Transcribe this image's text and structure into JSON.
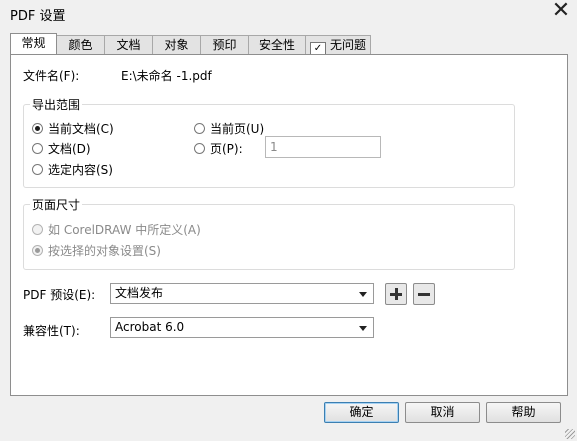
{
  "window": {
    "title": "PDF 设置",
    "close_glyph": "✕"
  },
  "tabs": [
    {
      "label": "常规",
      "active": true
    },
    {
      "label": "颜色"
    },
    {
      "label": "文档"
    },
    {
      "label": "对象"
    },
    {
      "label": "预印"
    },
    {
      "label": "安全性"
    },
    {
      "label": "无问题",
      "icon": "checklist-icon"
    }
  ],
  "general": {
    "filename_label": "文件名(F):",
    "filename_value": "E:\\未命名 -1.pdf",
    "export_range": {
      "title": "导出范围",
      "opt_current_doc": "当前文档(C)",
      "opt_doc": "文档(D)",
      "opt_selection": "选定内容(S)",
      "opt_current_page": "当前页(U)",
      "opt_pages": "页(P):",
      "pages_value": "1"
    },
    "page_size": {
      "title": "页面尺寸",
      "opt_as_defined": "如 CorelDRAW 中所定义(A)",
      "opt_by_object": "按选择的对象设置(S)"
    },
    "preset_label": "PDF 预设(E):",
    "preset_value": "文档发布",
    "compat_label": "兼容性(T):",
    "compat_value": "Acrobat 6.0"
  },
  "buttons": {
    "ok": "确定",
    "cancel": "取消",
    "help": "帮助"
  }
}
